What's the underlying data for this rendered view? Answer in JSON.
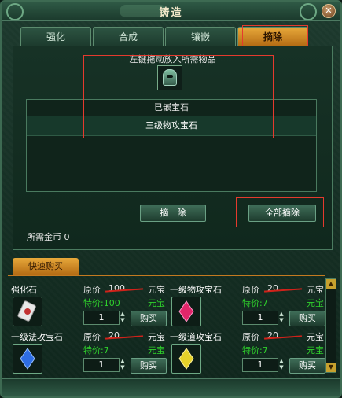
{
  "window": {
    "title": "铸造",
    "close_label": "✕"
  },
  "tabs": [
    {
      "label": "强化"
    },
    {
      "label": "合成"
    },
    {
      "label": "镶嵌"
    },
    {
      "label": "摘除"
    }
  ],
  "main": {
    "hint": "左键拖动放入所需物品",
    "slot_icon": "helmet-icon",
    "list_header": "已嵌宝石",
    "gems": [
      "三级物攻宝石"
    ],
    "remove_button": "摘　除",
    "remove_all_button": "全部摘除",
    "cost_label": "所需金币",
    "cost_value": "0"
  },
  "quick_buy": {
    "tab_label": "快速购买",
    "orig_label": "原价",
    "special_label": "特价:",
    "currency": "元宝",
    "buy_label": "购买",
    "items": [
      {
        "name": "强化石",
        "orig_price": "100",
        "special_price": "100",
        "qty": "1",
        "icon": "strengthen-stone-icon"
      },
      {
        "name": "一级物攻宝石",
        "orig_price": "20",
        "special_price": "7",
        "qty": "1",
        "icon": "red-gem-icon"
      },
      {
        "name": "一级法攻宝石",
        "orig_price": "20",
        "special_price": "7",
        "qty": "1",
        "icon": "blue-gem-icon"
      },
      {
        "name": "一级道攻宝石",
        "orig_price": "20",
        "special_price": "7",
        "qty": "1",
        "icon": "yellow-gem-icon"
      }
    ]
  },
  "colors": {
    "accent": "#e7a83a",
    "special_price": "#2fd12c",
    "annotation": "#e53a2e",
    "strike": "#d0221a"
  }
}
